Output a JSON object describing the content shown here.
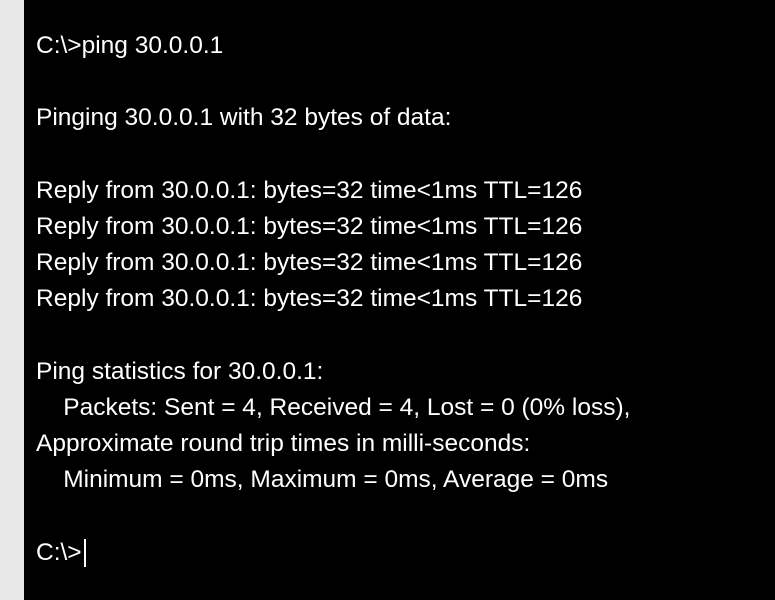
{
  "terminal": {
    "lines": [
      "C:\\>ping 30.0.0.1",
      "",
      "Pinging 30.0.0.1 with 32 bytes of data:",
      "",
      "Reply from 30.0.0.1: bytes=32 time<1ms TTL=126",
      "Reply from 30.0.0.1: bytes=32 time<1ms TTL=126",
      "Reply from 30.0.0.1: bytes=32 time<1ms TTL=126",
      "Reply from 30.0.0.1: bytes=32 time<1ms TTL=126",
      "",
      "Ping statistics for 30.0.0.1:",
      "    Packets: Sent = 4, Received = 4, Lost = 0 (0% loss),",
      "Approximate round trip times in milli-seconds:",
      "    Minimum = 0ms, Maximum = 0ms, Average = 0ms",
      ""
    ],
    "prompt": "C:\\>"
  },
  "colors": {
    "background": "#000000",
    "text": "#ffffff",
    "border": "#e8e8e8"
  }
}
